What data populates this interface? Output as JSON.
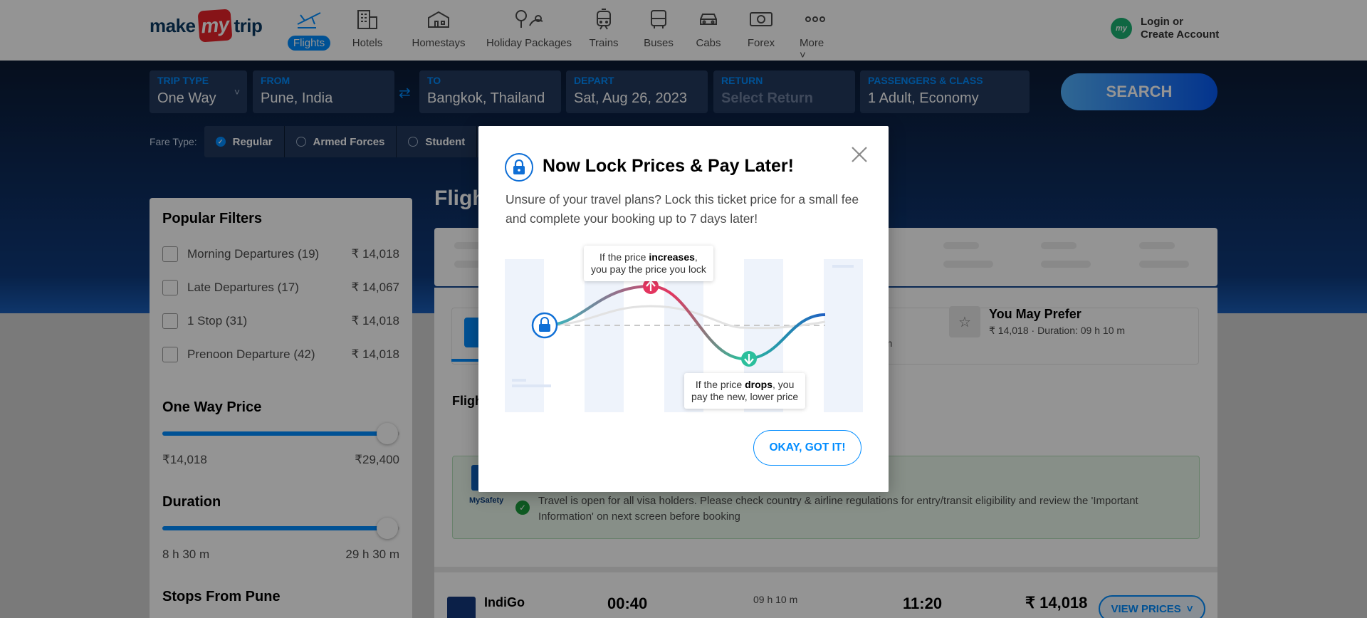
{
  "header": {
    "logo": {
      "pre": "make",
      "mid": "my",
      "post": "trip"
    },
    "nav": [
      {
        "label": "Flights",
        "icon": "airplane-icon",
        "active": true
      },
      {
        "label": "Hotels",
        "icon": "hotel-icon"
      },
      {
        "label": "Homestays",
        "icon": "homestay-icon"
      },
      {
        "label": "Holiday Packages",
        "icon": "holiday-packages-icon"
      },
      {
        "label": "Trains",
        "icon": "train-icon"
      },
      {
        "label": "Buses",
        "icon": "bus-icon"
      },
      {
        "label": "Cabs",
        "icon": "cab-icon"
      },
      {
        "label": "Forex",
        "icon": "forex-icon"
      },
      {
        "label": "More",
        "icon": "more-icon"
      }
    ],
    "login": {
      "avatar": "my",
      "line1": "Login or",
      "line2": "Create Account"
    }
  },
  "search": {
    "trip_type": {
      "label": "TRIP TYPE",
      "value": "One Way"
    },
    "from": {
      "label": "FROM",
      "value": "Pune, India"
    },
    "to": {
      "label": "TO",
      "value": "Bangkok, Thailand"
    },
    "depart": {
      "label": "DEPART",
      "value": "Sat, Aug 26, 2023"
    },
    "return": {
      "label": "RETURN",
      "value": "Select Return"
    },
    "passengers": {
      "label": "PASSENGERS & CLASS",
      "value": "1 Adult, Economy"
    },
    "button": "SEARCH",
    "fare_type_label": "Fare Type:",
    "fare_types": [
      "Regular",
      "Armed Forces",
      "Student"
    ]
  },
  "filters": {
    "popular_title": "Popular Filters",
    "popular": [
      {
        "name": "Morning Departures (19)",
        "price": "₹ 14,018"
      },
      {
        "name": "Late Departures (17)",
        "price": "₹ 14,067"
      },
      {
        "name": "1 Stop (31)",
        "price": "₹ 14,018"
      },
      {
        "name": "Prenoon Departure (42)",
        "price": "₹ 14,018"
      }
    ],
    "price_title": "One Way Price",
    "price_min": "₹14,018",
    "price_max": "₹29,400",
    "price_level": 0.95,
    "duration_title": "Duration",
    "duration_min": "8 h 30 m",
    "duration_max": "29 h 30 m",
    "duration_level": 0.95,
    "stops_title": "Stops From Pune"
  },
  "results": {
    "title": "Fligh",
    "prefer_title": "You May Prefer",
    "prefer_price": "₹ 14,018",
    "prefer_duration": "Duration: 09 h 10 m",
    "partial_minutes": "0 m",
    "flights_label": "Fligh",
    "safety_brand": "MySafety",
    "safety_msg": "Travel is open for all visa holders. Please check country & airline regulations for entry/transit eligibility and review the 'Important Information' on next screen before booking",
    "flight": {
      "airline": "IndiGo",
      "depart_time": "00:40",
      "duration": "09 h 10 m",
      "arrive_time": "11:20",
      "price": "₹ 14,018",
      "button": "VIEW PRICES"
    }
  },
  "modal": {
    "title": "Now Lock Prices & Pay Later!",
    "description": "Unsure of your travel plans? Lock this ticket price for a small fee and complete your booking up to 7 days later!",
    "callout_up": {
      "pre": "If the price ",
      "bold": "increases",
      "post": ",",
      "line2": "you pay the price you lock"
    },
    "callout_down": {
      "pre": "If the price ",
      "bold": "drops",
      "post": ", you",
      "line2": "pay the new, lower price"
    },
    "button": "OKAY, GOT IT!"
  },
  "colors": {
    "brand_blue": "#008cff",
    "price_up": "#e3355f",
    "price_down": "#2bbf9c"
  }
}
